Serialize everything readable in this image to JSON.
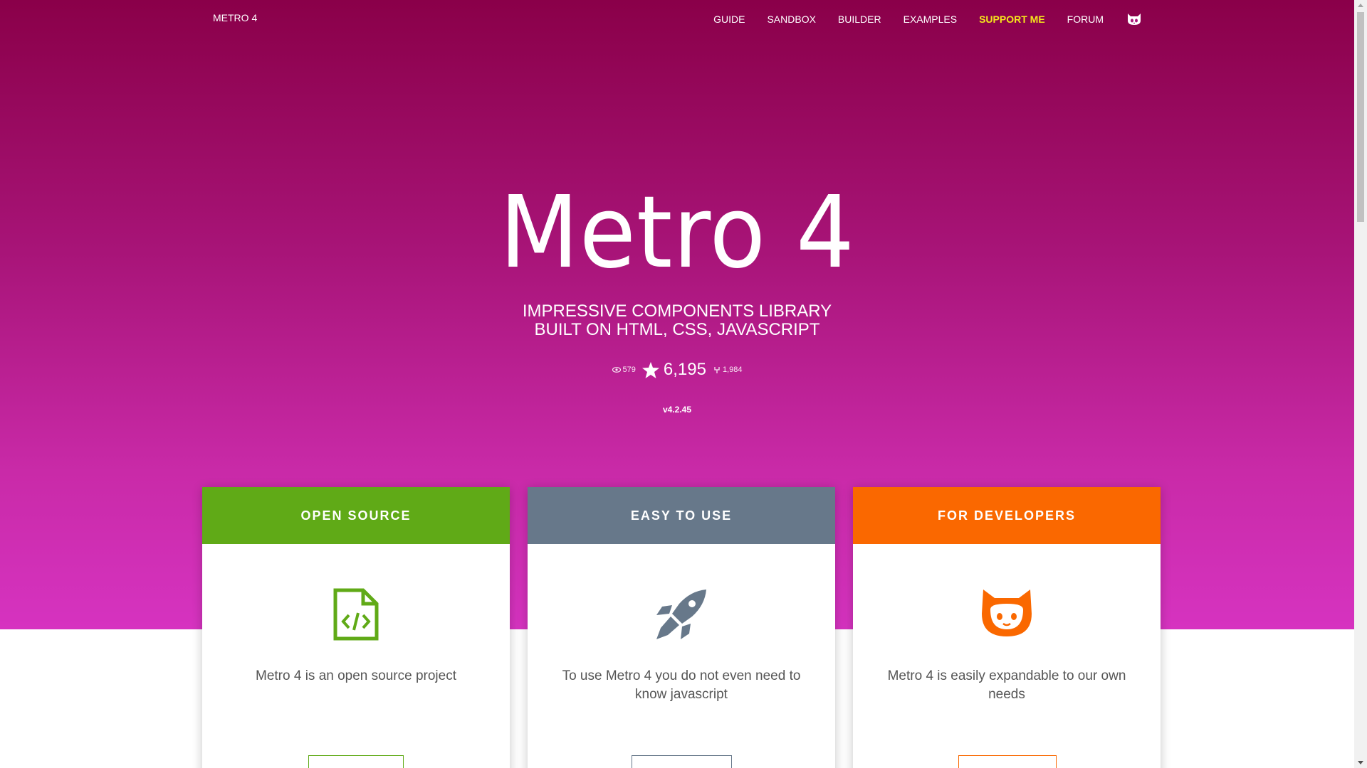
{
  "nav": {
    "brand": "METRO 4",
    "items": [
      {
        "label": "GUIDE"
      },
      {
        "label": "SANDBOX"
      },
      {
        "label": "BUILDER"
      },
      {
        "label": "EXAMPLES"
      },
      {
        "label": "SUPPORT ME"
      },
      {
        "label": "FORUM"
      }
    ],
    "github_icon": "github-icon"
  },
  "hero": {
    "title": "Metro 4",
    "subtitle_line1": "IMPRESSIVE COMPONENTS LIBRARY",
    "subtitle_line2": "BUILT ON HTML, CSS, JAVASCRIPT",
    "watchers": "579",
    "stars": "6,195",
    "forks": "1,984",
    "version": "v4.2.45"
  },
  "cards": [
    {
      "title": "OPEN SOURCE",
      "text": "Metro 4 is an open source project",
      "color": "#60aa17",
      "icon": "code-file-icon"
    },
    {
      "title": "EASY TO USE",
      "text": "To use Metro 4 you do not even need to know javascript",
      "color": "#67788a",
      "icon": "rocket-icon"
    },
    {
      "title": "FOR DEVELOPERS",
      "text": "Metro 4 is easily expandable to our own needs",
      "color": "#fa6800",
      "icon": "github-icon"
    }
  ],
  "colors": {
    "hero_top": "#8a0049",
    "hero_bottom": "#d633c0",
    "support_link": "#f5e51b"
  }
}
